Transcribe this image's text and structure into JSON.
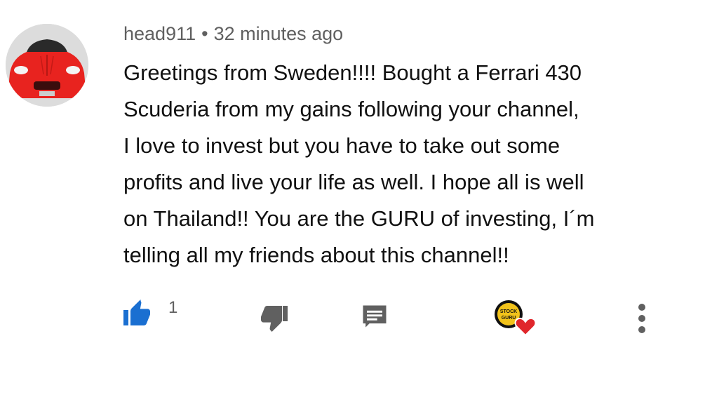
{
  "comment": {
    "author": "head911",
    "separator": "•",
    "timestamp": "32 minutes ago",
    "text_lines": [
      "Greetings from Sweden!!!! Bought a Ferrari 430",
      "Scuderia from my gains following your channel,",
      "I love to invest but you have to take out some",
      "profits and live your life as well. I hope all is well",
      "on Thailand!! You are the GURU of investing, I´m",
      "telling all my friends about this channel!!"
    ],
    "avatar_icon": "red-ferrari-car-avatar"
  },
  "actions": {
    "like_count": "1",
    "like_icon": "thumbs-up-icon",
    "dislike_icon": "thumbs-down-icon",
    "reply_icon": "comment-reply-icon",
    "creator_heart_icon": "creator-heart-icon",
    "creator_logo_text_1": "STOCK",
    "creator_logo_text_2": "GURU",
    "more_icon": "more-vertical-icon"
  },
  "colors": {
    "like_active": "#1a6fd1",
    "icon_gray": "#606060",
    "heart": "#e0262b",
    "text": "#111111"
  }
}
